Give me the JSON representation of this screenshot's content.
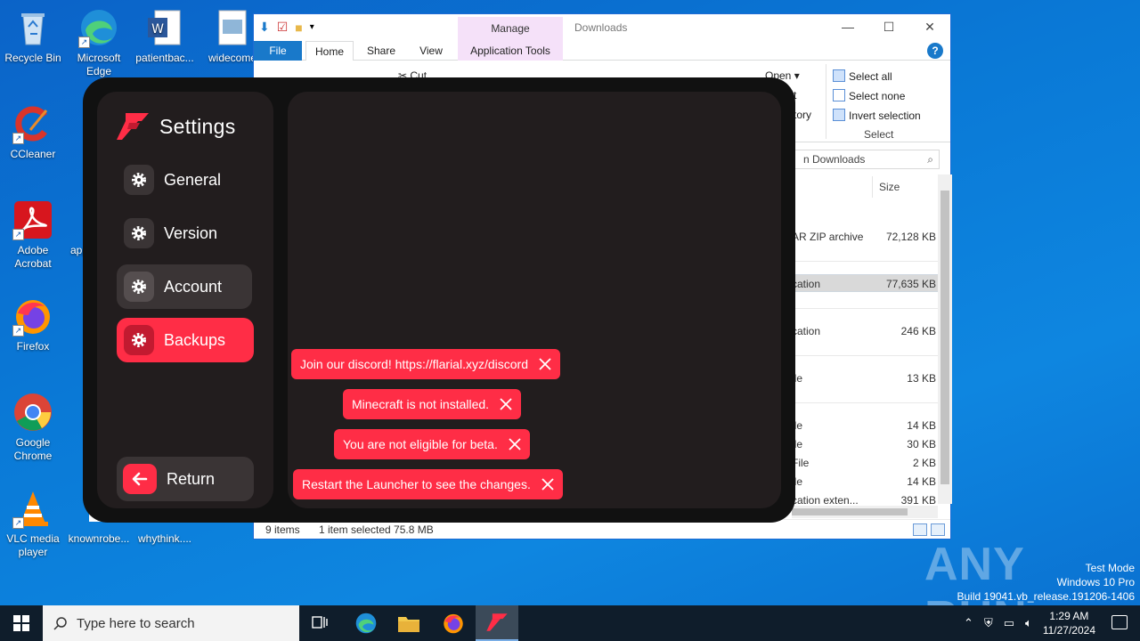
{
  "desktop": {
    "icons": [
      {
        "label": "Recycle Bin",
        "icon": "recycle-bin-icon"
      },
      {
        "label": "Microsoft Edge",
        "icon": "edge-icon"
      },
      {
        "label": "patientbac...",
        "icon": "word-doc-icon"
      },
      {
        "label": "widecome",
        "icon": "image-file-icon"
      },
      {
        "label": "CCleaner",
        "icon": "ccleaner-icon"
      },
      {
        "label": "Adobe Acrobat",
        "icon": "acrobat-icon"
      },
      {
        "label": "app",
        "icon": "file-icon"
      },
      {
        "label": "Firefox",
        "icon": "firefox-icon"
      },
      {
        "label": "Google Chrome",
        "icon": "chrome-icon"
      },
      {
        "label": "VLC media player",
        "icon": "vlc-icon"
      },
      {
        "label": "knownrobe...",
        "icon": "file-icon"
      },
      {
        "label": "whythink....",
        "icon": "file-icon"
      }
    ]
  },
  "explorer": {
    "title": "Downloads",
    "manage_label": "Manage",
    "tabs": {
      "file": "File",
      "home": "Home",
      "share": "Share",
      "view": "View",
      "app_tools": "Application Tools"
    },
    "ribbon": {
      "cut": "Cut",
      "open": "Open",
      "select_all": "Select all",
      "select_none": "Select none",
      "invert_selection": "Invert selection",
      "select_group": "Select",
      "partial_1": "t",
      "partial_2": "tory"
    },
    "search_placeholder": "n Downloads",
    "column_size": "Size",
    "rows": [
      {
        "type": "AR ZIP archive",
        "size": "72,128 KB"
      },
      {
        "type": "cation",
        "size": "77,635 KB"
      },
      {
        "type": "cation",
        "size": "246 KB"
      },
      {
        "type": "ile",
        "size": "13 KB"
      },
      {
        "type": "ile",
        "size": "14 KB"
      },
      {
        "type": "ile",
        "size": "30 KB"
      },
      {
        "type": "File",
        "size": "2 KB"
      },
      {
        "type": "ile",
        "size": "14 KB"
      },
      {
        "type": "cation exten...",
        "size": "391 KB"
      }
    ],
    "status_items": "9 items",
    "status_selected": "1 item selected  75.8 MB"
  },
  "launcher": {
    "title": "Settings",
    "accent": "#ff2d46",
    "nav": [
      {
        "label": "General"
      },
      {
        "label": "Version"
      },
      {
        "label": "Account"
      },
      {
        "label": "Backups"
      }
    ],
    "return_label": "Return",
    "toasts": [
      {
        "text": "Join our discord! https://flarial.xyz/discord"
      },
      {
        "text": "Minecraft is not installed."
      },
      {
        "text": "You are not eligible for beta."
      },
      {
        "text": "Restart the Launcher to see the changes."
      }
    ]
  },
  "watermark": {
    "brand": "ANY RUN",
    "line1": "Test Mode",
    "line2": "Windows 10 Pro",
    "line3": "Build 19041.vb_release.191206-1406"
  },
  "taskbar": {
    "search_placeholder": "Type here to search",
    "time": "1:29 AM",
    "date": "11/27/2024"
  }
}
